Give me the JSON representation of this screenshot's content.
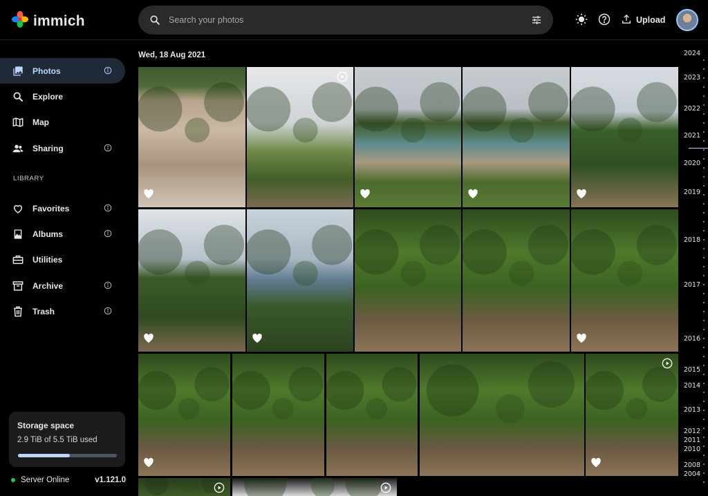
{
  "app": {
    "name": "immich"
  },
  "search": {
    "placeholder": "Search your photos"
  },
  "header": {
    "upload_label": "Upload"
  },
  "sidebar": {
    "items": [
      {
        "label": "Photos",
        "icon": "photos-icon",
        "active": true,
        "info": true
      },
      {
        "label": "Explore",
        "icon": "explore-icon",
        "info": false
      },
      {
        "label": "Map",
        "icon": "map-icon",
        "info": false
      },
      {
        "label": "Sharing",
        "icon": "sharing-icon",
        "info": true
      }
    ],
    "library_label": "LIBRARY",
    "library_items": [
      {
        "label": "Favorites",
        "icon": "heart-icon",
        "info": true
      },
      {
        "label": "Albums",
        "icon": "albums-icon",
        "info": true
      },
      {
        "label": "Utilities",
        "icon": "utilities-icon",
        "info": false
      },
      {
        "label": "Archive",
        "icon": "archive-icon",
        "info": true
      },
      {
        "label": "Trash",
        "icon": "trash-icon",
        "info": true
      }
    ]
  },
  "storage": {
    "title": "Storage space",
    "used_text": "2.9 TiB of 5.5 TiB used",
    "used_fraction": 0.527
  },
  "server": {
    "status": "Server Online",
    "version": "v1.121.0"
  },
  "main": {
    "date_title": "Wed, 18 Aug 2021"
  },
  "timeline": {
    "years": [
      "2024",
      "2023",
      "2022",
      "2021",
      "2020",
      "2019",
      "2018",
      "2017",
      "2016",
      "2015",
      "2014",
      "2013",
      "2012",
      "2011",
      "2010",
      "2008",
      "2004"
    ],
    "current_year": "2021"
  },
  "photos": [
    {
      "favorite": true,
      "video": false,
      "scene": "beach-family"
    },
    {
      "favorite": false,
      "video": true,
      "scene": "cliff-path"
    },
    {
      "favorite": true,
      "video": false,
      "scene": "cove"
    },
    {
      "favorite": true,
      "video": false,
      "scene": "cove"
    },
    {
      "favorite": true,
      "video": false,
      "scene": "coast-path"
    },
    {
      "favorite": true,
      "video": false,
      "scene": "coast-hill"
    },
    {
      "favorite": true,
      "video": false,
      "scene": "sea-view"
    },
    {
      "favorite": false,
      "video": false,
      "scene": "forest-path"
    },
    {
      "favorite": false,
      "video": false,
      "scene": "forest-path"
    },
    {
      "favorite": true,
      "video": false,
      "scene": "forest-path"
    },
    {
      "favorite": true,
      "video": false,
      "scene": "forest-path"
    },
    {
      "favorite": false,
      "video": false,
      "scene": "forest-path"
    },
    {
      "favorite": false,
      "video": false,
      "scene": "forest-path"
    },
    {
      "favorite": false,
      "video": false,
      "scene": "forest-path"
    },
    {
      "favorite": true,
      "video": true,
      "scene": "forest-path"
    },
    {
      "favorite": false,
      "video": true,
      "scene": "forest-dark"
    },
    {
      "favorite": false,
      "video": true,
      "scene": "car-window"
    }
  ]
}
